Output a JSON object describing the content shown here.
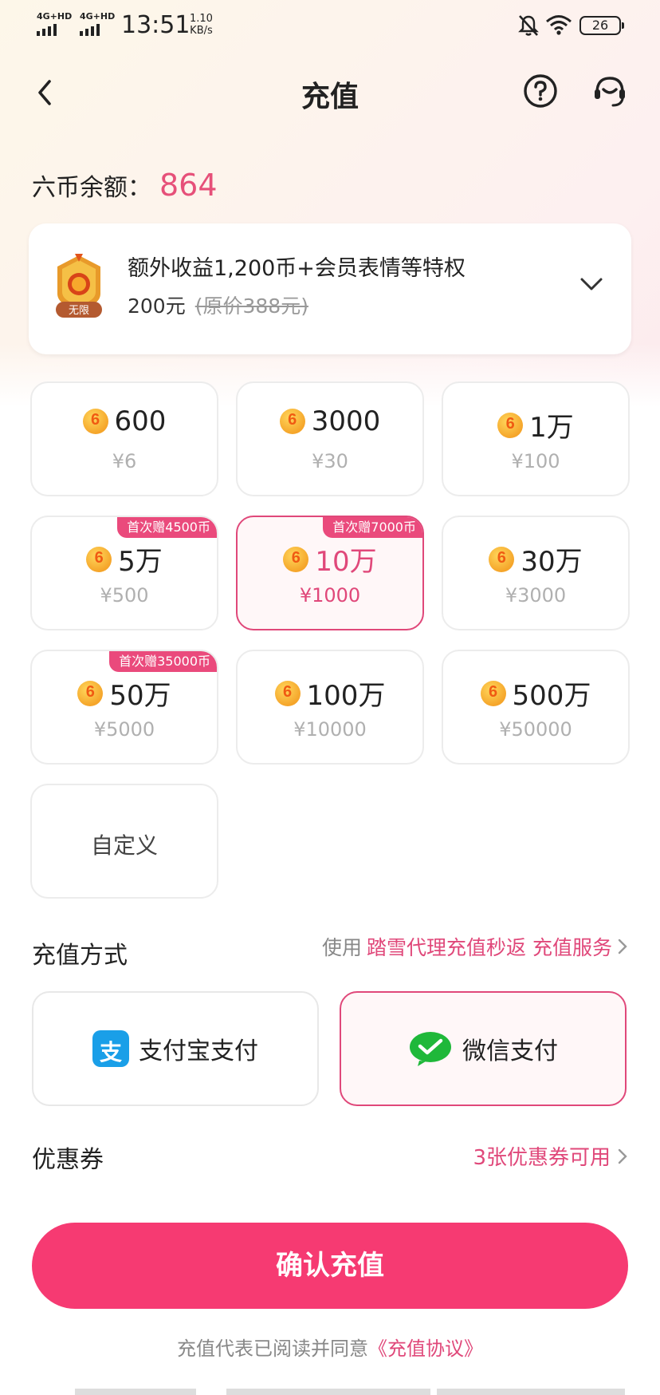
{
  "status_bar": {
    "net1": "4G+HD",
    "net2": "4G+HD",
    "time": "13:51",
    "speed_value": "1.10",
    "speed_unit": "KB/s",
    "battery": "26",
    "icons": [
      "mute-bell-icon",
      "wifi-icon",
      "battery-icon"
    ]
  },
  "header": {
    "title": "充值",
    "icons": [
      "back-icon",
      "help-icon",
      "customer-service-icon"
    ]
  },
  "balance": {
    "label": "六币余额：",
    "value": "864"
  },
  "promo": {
    "badge_label": "无限",
    "title": "额外收益1,200币+会员表情等特权",
    "price": "200元",
    "original_price": "(原价388元)"
  },
  "packages": [
    {
      "amount": "600",
      "price": "¥6",
      "tag": "",
      "selected": false
    },
    {
      "amount": "3000",
      "price": "¥30",
      "tag": "",
      "selected": false
    },
    {
      "amount": "1万",
      "price": "¥100",
      "tag": "",
      "selected": false
    },
    {
      "amount": "5万",
      "price": "¥500",
      "tag": "首次赠4500币",
      "selected": false
    },
    {
      "amount": "10万",
      "price": "¥1000",
      "tag": "首次赠7000币",
      "selected": true
    },
    {
      "amount": "30万",
      "price": "¥3000",
      "tag": "",
      "selected": false
    },
    {
      "amount": "50万",
      "price": "¥5000",
      "tag": "首次赠35000币",
      "selected": false
    },
    {
      "amount": "100万",
      "price": "¥10000",
      "tag": "",
      "selected": false
    },
    {
      "amount": "500万",
      "price": "¥50000",
      "tag": "",
      "selected": false
    }
  ],
  "custom_label": "自定义",
  "payment": {
    "section_label": "充值方式",
    "link_prefix": "使用",
    "link_highlight": "踏雪代理充值秒返 充值服务",
    "alipay_label": "支付宝支付",
    "alipay_glyph": "支",
    "wechat_label": "微信支付",
    "selected": "wechat"
  },
  "coupon": {
    "section_label": "优惠券",
    "link": "3张优惠券可用"
  },
  "confirm_label": "确认充值",
  "agreement": {
    "prefix": "充值代表已阅读并同意",
    "link": "《充值协议》"
  },
  "colors": {
    "accent": "#e0487a",
    "confirm": "#f63a72",
    "alipay": "#1a9fe8",
    "wechat": "#1fb83a"
  }
}
